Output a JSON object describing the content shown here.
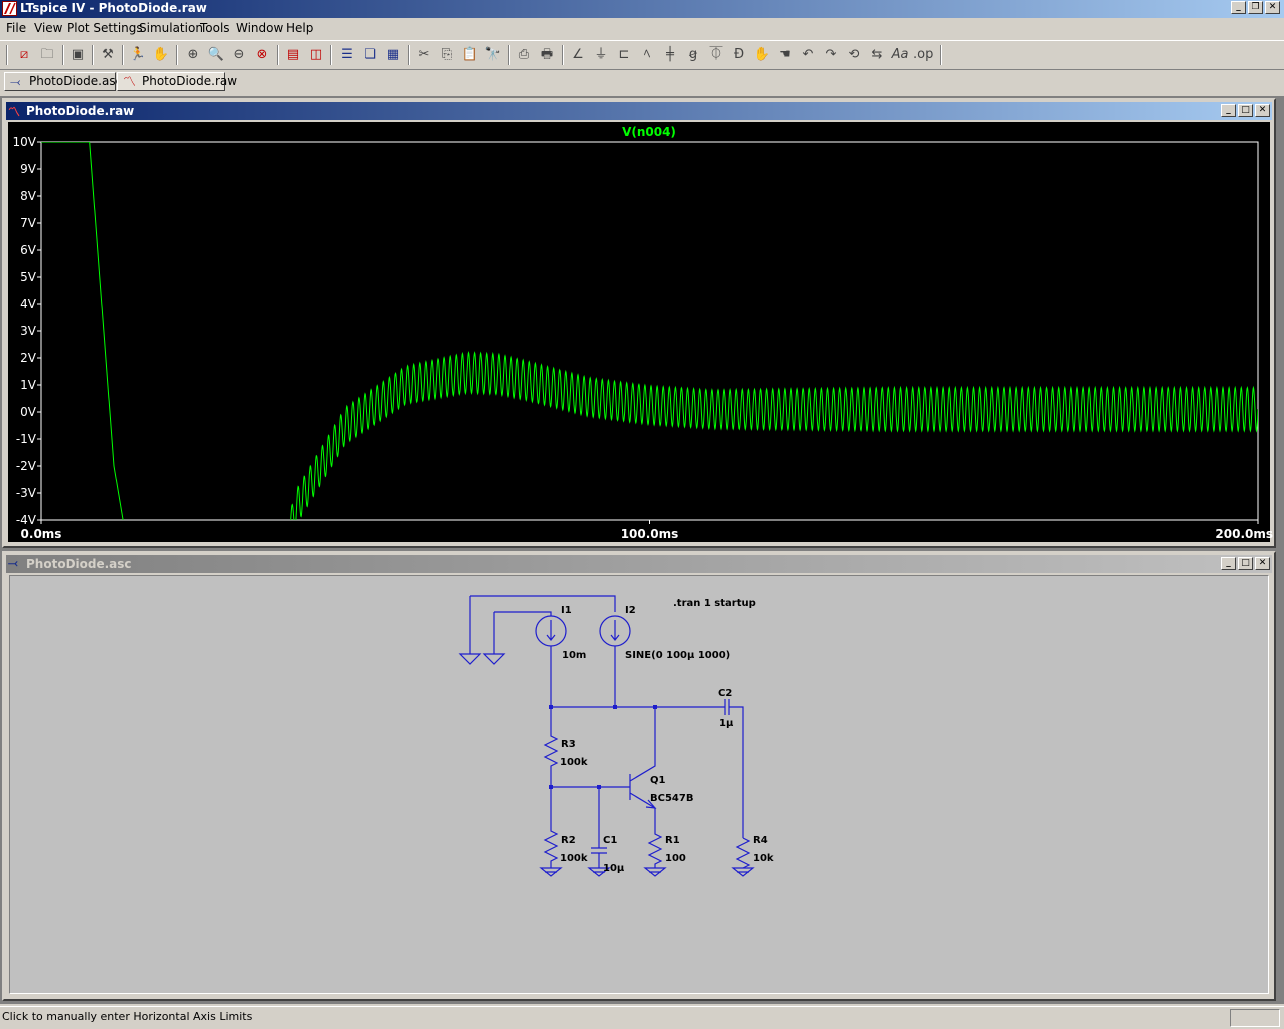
{
  "app": {
    "title": "LTspice IV - PhotoDiode.raw"
  },
  "menu": [
    "File",
    "View",
    "Plot Settings",
    "Simulation",
    "Tools",
    "Window",
    "Help"
  ],
  "tabs": [
    {
      "label": "PhotoDiode.asc",
      "icon": "schematic-icon"
    },
    {
      "label": "PhotoDiode.raw",
      "icon": "waveform-icon"
    }
  ],
  "plot_window": {
    "title": "PhotoDiode.raw",
    "icon": "waveform-icon"
  },
  "schematic_window": {
    "title": "PhotoDiode.asc",
    "icon": "schematic-icon"
  },
  "colors": {
    "trace": "#00ff00",
    "wire": "#1e1ecc",
    "plot_bg": "#000000",
    "schematic_bg": "#c0c0c0"
  },
  "chart_data": {
    "type": "line",
    "title": "V(n004)",
    "series": [
      {
        "name": "V(n004)"
      }
    ],
    "y_ticks": [
      "10V",
      "9V",
      "8V",
      "7V",
      "6V",
      "5V",
      "4V",
      "3V",
      "2V",
      "1V",
      "0V",
      "-1V",
      "-2V",
      "-3V",
      "-4V"
    ],
    "x_ticks": [
      "0.0ms",
      "100.0ms",
      "200.0ms"
    ],
    "xlim_ms": [
      0,
      200
    ],
    "ylim_v": [
      -4,
      10
    ],
    "envelope": {
      "x_ms": [
        0,
        2,
        8,
        10,
        12,
        15,
        38,
        42,
        50,
        60,
        70,
        75,
        80,
        90,
        100,
        110,
        120,
        140,
        160,
        200
      ],
      "y_center_v": [
        10,
        10,
        10,
        4,
        -2,
        -6,
        -6,
        -3.5,
        -0.5,
        1.0,
        1.45,
        1.4,
        1.15,
        0.55,
        0.25,
        0.1,
        0.1,
        0.1,
        0.1,
        0.1
      ],
      "y_amplitude_v": [
        0,
        0,
        0,
        0,
        0,
        0,
        0,
        0.65,
        0.68,
        0.7,
        0.75,
        0.75,
        0.73,
        0.72,
        0.72,
        0.72,
        0.75,
        0.8,
        0.8,
        0.8
      ]
    },
    "oscillation_frequency_hz": 1000
  },
  "schematic": {
    "directive": ".tran 1 startup",
    "I1": {
      "name": "I1",
      "value": "10m"
    },
    "I2": {
      "name": "I2",
      "value": "SINE(0 100µ 1000)"
    },
    "C2": {
      "name": "C2",
      "value": "1µ"
    },
    "R3": {
      "name": "R3",
      "value": "100k"
    },
    "Q1": {
      "name": "Q1",
      "value": "BC547B"
    },
    "R2": {
      "name": "R2",
      "value": "100k"
    },
    "C1": {
      "name": "C1",
      "value": "10µ"
    },
    "R1": {
      "name": "R1",
      "value": "100"
    },
    "R4": {
      "name": "R4",
      "value": "10k"
    }
  },
  "status": {
    "text": "Click to manually enter Horizontal Axis Limits"
  }
}
